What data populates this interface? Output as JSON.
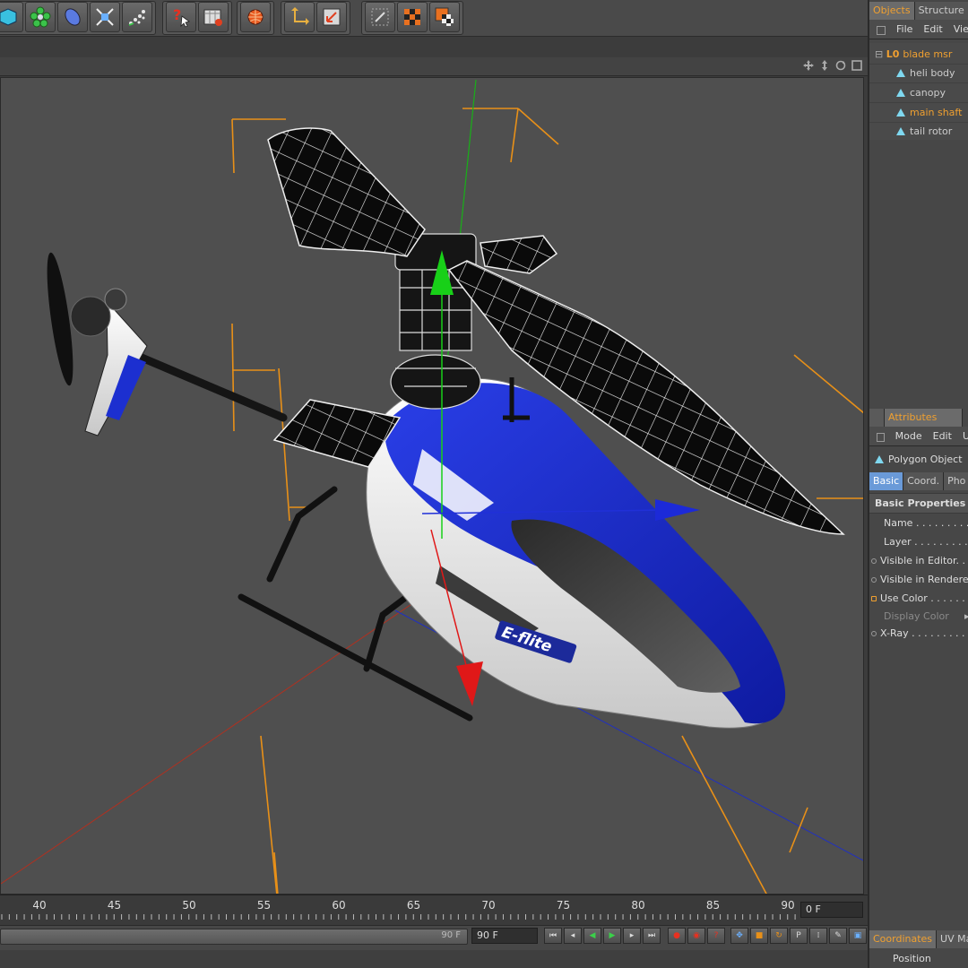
{
  "toolbar": {
    "groups": [
      {
        "icons": [
          "cube-icon",
          "flower-deformer-icon",
          "sphere-blue-icon",
          "spline-expand-icon",
          "particles-icon"
        ]
      },
      {
        "icons": [
          "help-cursor-icon",
          "render-settings-icon"
        ]
      },
      {
        "icons": [
          "render-region-icon"
        ]
      },
      {
        "icons": [
          "axis-move-icon",
          "coordinate-system-icon"
        ]
      },
      {
        "icons": [
          "snap-icon",
          "checker-texture-icon",
          "checker-material-icon"
        ]
      }
    ]
  },
  "viewport": {
    "nav_icons": [
      "move-view-icon",
      "dolly-icon",
      "rotate-view-icon",
      "maximize-view-icon"
    ],
    "logo_text": "E-flite"
  },
  "timeline": {
    "ticks": [
      "40",
      "45",
      "50",
      "55",
      "60",
      "65",
      "70",
      "75",
      "80",
      "85",
      "90"
    ],
    "current_frame": "0 F",
    "end_frame_a": "90 F",
    "end_frame_b": "90 F"
  },
  "objects_panel": {
    "tabs": [
      {
        "label": "Objects",
        "active": true
      },
      {
        "label": "Structure",
        "active": false
      }
    ],
    "menu": [
      "File",
      "Edit",
      "Vie"
    ],
    "tree": [
      {
        "label": "blade msr",
        "level": 0,
        "highlight": true,
        "icon": "null-object-icon"
      },
      {
        "label": "heli body",
        "level": 1,
        "highlight": false,
        "icon": "polygon-object-icon"
      },
      {
        "label": "canopy",
        "level": 1,
        "highlight": false,
        "icon": "polygon-object-icon"
      },
      {
        "label": "main shaft",
        "level": 1,
        "highlight": true,
        "icon": "polygon-object-icon"
      },
      {
        "label": "tail rotor",
        "level": 1,
        "highlight": false,
        "icon": "polygon-object-icon"
      }
    ]
  },
  "attributes_panel": {
    "title": "Attributes",
    "menu": [
      "Mode",
      "Edit",
      "U"
    ],
    "object_type": "Polygon Object",
    "tabs": [
      {
        "label": "Basic",
        "active": true
      },
      {
        "label": "Coord.",
        "active": false
      },
      {
        "label": "Pho",
        "active": false
      }
    ],
    "section_title": "Basic Properties",
    "properties": [
      {
        "label": "Name . . . . . . . . . .",
        "marker": "none"
      },
      {
        "label": "Layer . . . . . . . . . .",
        "marker": "none"
      },
      {
        "label": "Visible in Editor. .",
        "marker": "dot"
      },
      {
        "label": "Visible in Renderer",
        "marker": "dot"
      },
      {
        "label": "Use Color . . . . . . .",
        "marker": "orange"
      },
      {
        "label": "Display Color",
        "marker": "none",
        "dim": true
      },
      {
        "label": "X-Ray . . . . . . . . .",
        "marker": "dot"
      }
    ]
  },
  "coordinates_panel": {
    "tabs": [
      {
        "label": "Coordinates",
        "active": true
      },
      {
        "label": "UV Ma",
        "active": false
      }
    ],
    "first_row": "Position"
  },
  "colors": {
    "accent_orange": "#f0a030",
    "helicopter_blue": "#1c2fd0",
    "axis_green": "#18d018",
    "axis_red": "#e01818",
    "axis_blue": "#1c2ad8"
  }
}
